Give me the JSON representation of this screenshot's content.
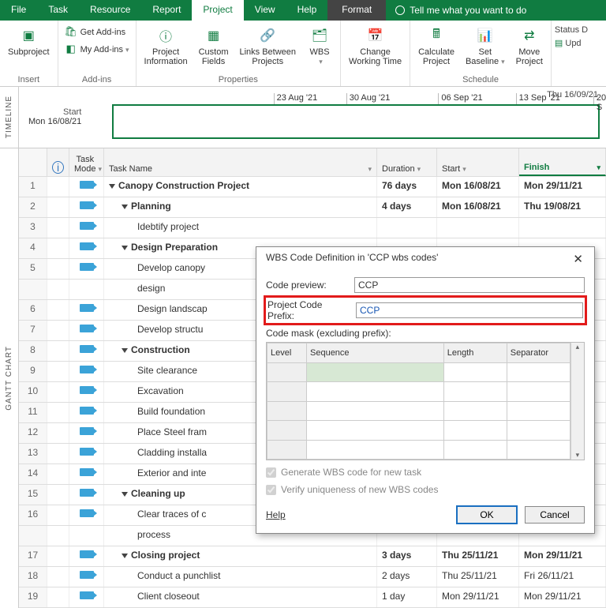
{
  "menu": {
    "items": [
      "File",
      "Task",
      "Resource",
      "Report",
      "Project",
      "View",
      "Help"
    ],
    "active": 4,
    "format": "Format",
    "tell": "Tell me what you want to do"
  },
  "ribbon": {
    "groups": {
      "insert": {
        "label": "Insert",
        "subproject": "Subproject"
      },
      "addins": {
        "label": "Add-ins",
        "get": "Get Add-ins",
        "my": "My Add-ins"
      },
      "properties": {
        "label": "Properties",
        "info": "Project\nInformation",
        "custom": "Custom\nFields",
        "links": "Links Between\nProjects",
        "wbs": "WBS"
      },
      "changewt": "Change\nWorking Time",
      "schedule": {
        "label": "Schedule",
        "calc": "Calculate\nProject",
        "baseline": "Set\nBaseline",
        "move": "Move\nProject"
      }
    },
    "right": {
      "status": "Status D",
      "update": "Upd"
    }
  },
  "timeline": {
    "label": "TIMELINE",
    "today": "Thu 16/09/21",
    "start_lbl": "Start",
    "start_date": "Mon 16/08/21",
    "ticks": [
      {
        "pos": 33,
        "label": "23 Aug '21"
      },
      {
        "pos": 48,
        "label": "30 Aug '21"
      },
      {
        "pos": 67,
        "label": "06 Sep '21"
      },
      {
        "pos": 83,
        "label": "13 Sep '21"
      },
      {
        "pos": 99,
        "label": "20 S"
      }
    ]
  },
  "sidebar_label": "GANTT CHART",
  "columns": {
    "info": "",
    "mode": "Task\nMode",
    "name": "Task Name",
    "duration": "Duration",
    "start": "Start",
    "finish": "Finish"
  },
  "tasks": [
    {
      "n": "1",
      "name": "Canopy Construction Project",
      "dur": "76 days",
      "start": "Mon 16/08/21",
      "finish": "Mon 29/11/21",
      "ind": 0,
      "sum": true,
      "bold": true
    },
    {
      "n": "2",
      "name": "Planning",
      "dur": "4 days",
      "start": "Mon 16/08/21",
      "finish": "Thu 19/08/21",
      "ind": 1,
      "sum": true,
      "bold": true
    },
    {
      "n": "3",
      "name": "Idebtify project",
      "ind": 2
    },
    {
      "n": "4",
      "name": "Design Preparation",
      "ind": 1,
      "sum": true,
      "bold": true
    },
    {
      "n": "5",
      "name": "Develop canopy",
      "ind": 2
    },
    {
      "n": "",
      "name": "design",
      "ind": 2,
      "cont": true
    },
    {
      "n": "6",
      "name": "Design landscap",
      "ind": 2
    },
    {
      "n": "7",
      "name": "Develop structu",
      "ind": 2
    },
    {
      "n": "8",
      "name": "Construction",
      "ind": 1,
      "sum": true,
      "bold": true
    },
    {
      "n": "9",
      "name": "Site clearance",
      "ind": 2
    },
    {
      "n": "10",
      "name": "Excavation",
      "ind": 2
    },
    {
      "n": "11",
      "name": "Build foundation",
      "ind": 2
    },
    {
      "n": "12",
      "name": "Place Steel fram",
      "ind": 2
    },
    {
      "n": "13",
      "name": "Cladding installa",
      "ind": 2
    },
    {
      "n": "14",
      "name": "Exterior and inte",
      "ind": 2
    },
    {
      "n": "15",
      "name": "Cleaning up",
      "ind": 1,
      "sum": true,
      "bold": true
    },
    {
      "n": "16",
      "name": "Clear traces of c",
      "ind": 2
    },
    {
      "n": "",
      "name": "process",
      "ind": 2,
      "cont": true
    },
    {
      "n": "17",
      "name": "Closing project",
      "dur": "3 days",
      "start": "Thu 25/11/21",
      "finish": "Mon 29/11/21",
      "ind": 1,
      "sum": true,
      "bold": true
    },
    {
      "n": "18",
      "name": "Conduct a punchlist",
      "dur": "2 days",
      "start": "Thu 25/11/21",
      "finish": "Fri 26/11/21",
      "ind": 2
    },
    {
      "n": "19",
      "name": "Client closeout",
      "dur": "1 day",
      "start": "Mon 29/11/21",
      "finish": "Mon 29/11/21",
      "ind": 2
    }
  ],
  "dialog": {
    "title": "WBS Code Definition in 'CCP wbs codes'",
    "preview_lbl": "Code preview:",
    "preview_val": "CCP",
    "prefix_lbl": "Project Code Prefix:",
    "prefix_val": "CCP",
    "mask_lbl": "Code mask (excluding prefix):",
    "mask_cols": [
      "Level",
      "Sequence",
      "Length",
      "Separator"
    ],
    "gen": "Generate WBS code for new task",
    "verify": "Verify uniqueness of new WBS codes",
    "help": "Help",
    "ok": "OK",
    "cancel": "Cancel"
  }
}
